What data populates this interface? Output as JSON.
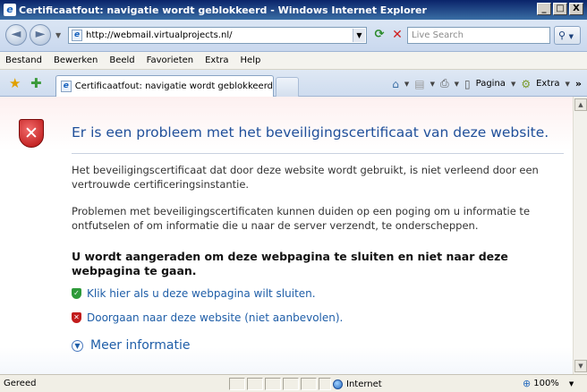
{
  "window": {
    "title": "Certificaatfout: navigatie wordt geblokkeerd - Windows Internet Explorer",
    "controls": [
      "_",
      "□",
      "X"
    ]
  },
  "address_bar": {
    "url": "http://webmail.virtualprojects.nl/",
    "search_placeholder": "Live Search"
  },
  "menu": {
    "items": [
      "Bestand",
      "Bewerken",
      "Beeld",
      "Favorieten",
      "Extra",
      "Help"
    ]
  },
  "tab": {
    "label": "Certificaatfout: navigatie wordt geblokkeerd"
  },
  "command_bar": {
    "page_label": "Pagina",
    "tools_label": "Extra"
  },
  "content": {
    "headline": "Er is een probleem met het beveiligingscertificaat van deze website.",
    "paragraph1": "Het beveiligingscertificaat dat door deze website wordt gebruikt, is niet verleend door een vertrouwde certificeringsinstantie.",
    "paragraph2": "Problemen met beveiligingscertificaten kunnen duiden op een poging om u informatie te ontfutselen of om informatie die u naar de server verzendt, te onderscheppen.",
    "warning": "U wordt aangeraden om deze webpagina te sluiten en niet naar deze webpagina te gaan.",
    "close_link": "Klik hier als u deze webpagina wilt sluiten.",
    "continue_link": "Doorgaan naar deze website (niet aanbevolen).",
    "more_info": "Meer informatie"
  },
  "status": {
    "text": "Gereed",
    "zone": "Internet",
    "zoom": "100%"
  },
  "colors": {
    "title_bar": "#0a246a",
    "link": "#1f5ea8",
    "headline": "#1f4f9a",
    "error_shield": "#c21c1c",
    "safe_shield": "#2e9a3a"
  }
}
